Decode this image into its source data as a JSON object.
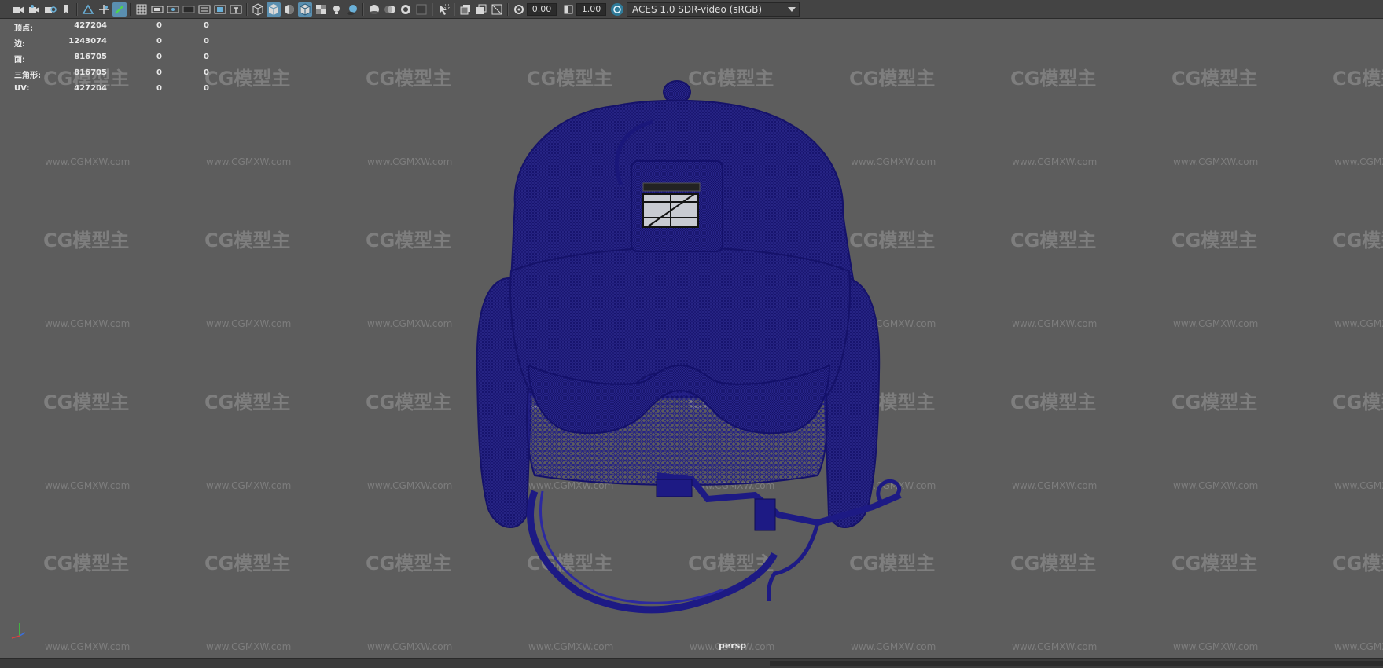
{
  "toolbar": {
    "icons": [
      "camera-icon",
      "camera-lock-icon",
      "camera-attributes-icon",
      "bookmark-icon",
      "image-plane-icon",
      "2d-pan-zoom-icon",
      "grease-pencil-icon",
      "grid-icon",
      "film-gate-icon",
      "resolution-gate-icon",
      "gate-mask-icon",
      "field-chart-icon",
      "safe-action-icon",
      "safe-title-icon",
      "wireframe-icon",
      "smooth-shade-icon",
      "flat-shade-icon",
      "wireframe-on-shaded-icon",
      "textured-icon",
      "lights-icon",
      "shadows-icon",
      "ambient-occlusion-icon",
      "motion-blur-icon",
      "anti-aliasing-icon",
      "depth-of-field-icon",
      "isolate-select-icon",
      "xray-icon",
      "xray-joints-icon",
      "xray-components-icon",
      "backface-culling-icon"
    ],
    "exposure_value": "0.00",
    "gamma_value": "1.00",
    "color_space": "ACES 1.0 SDR-video (sRGB)",
    "accent": "#5a8fb0"
  },
  "hud": {
    "rows": [
      {
        "label": "顶点:",
        "v1": "427204",
        "v2": "0",
        "v3": "0"
      },
      {
        "label": "边:",
        "v1": "1243074",
        "v2": "0",
        "v3": "0"
      },
      {
        "label": "面:",
        "v1": "816705",
        "v2": "0",
        "v3": "0"
      },
      {
        "label": "三角形:",
        "v1": "816705",
        "v2": "0",
        "v3": "0"
      },
      {
        "label": "UV:",
        "v1": "427204",
        "v2": "0",
        "v3": "0"
      }
    ]
  },
  "viewport": {
    "camera_label": "persp",
    "background": "#5d5d5d",
    "wire_color": "#1d1a80"
  },
  "watermark": {
    "logo": "CG模型主",
    "url": "www.CGMXW.com"
  }
}
